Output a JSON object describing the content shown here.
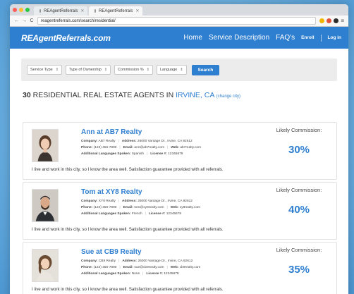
{
  "browser": {
    "tabs": [
      {
        "label": "REAgentReferrals"
      },
      {
        "label": "REAgentReferrals"
      }
    ],
    "url": "reagentreferrals.com/search/residential/",
    "colors": {
      "close": "#ff5f57",
      "min": "#febc2e",
      "max": "#28c840"
    }
  },
  "site": {
    "logo": "REAgentReferrals.com",
    "nav": {
      "home": "Home",
      "service": "Service Description",
      "faq": "FAQ's",
      "enroll": "Enroll",
      "login": "Log in"
    },
    "accent": "#2f7fd0"
  },
  "filters": {
    "service_type": "Service Type",
    "ownership": "Type of Ownership",
    "commission": "Commission %",
    "language": "Language",
    "search": "Search"
  },
  "results": {
    "count": "30",
    "label": "RESIDENTIAL REAL ESTATE AGENTS IN",
    "city": "IRVINE, CA",
    "change": "(change city)"
  },
  "commission_label": "Likely Commission:",
  "agents": [
    {
      "name": "Ann at AB7 Realty",
      "company": "AB7 Realty",
      "address": "26000 Vantage Dr., Irvine, CA 92612",
      "phone": "(123) 456-7890",
      "email": "ann@ab7realty.com",
      "web": "ab7realty.com",
      "languages": "Spanish",
      "license": "12345678",
      "description": "I live and work in this city, so I know the area well. Satisfaction guarantee provided with all referrals.",
      "commission": "30%"
    },
    {
      "name": "Tom at XY8 Realty",
      "company": "XY8 Realty",
      "address": "25000 Vantage Dr., Irvine, CA 92612",
      "phone": "(123) 456-7890",
      "email": "tom@xy8realty.com",
      "web": "xy8realty.com",
      "languages": "French",
      "license": "12345678",
      "description": "I live and work in this city, so I know the area well. Satisfaction guarantee provided with all referrals.",
      "commission": "40%"
    },
    {
      "name": "Sue at CB9 Realty",
      "company": "CB9 Realty",
      "address": "26000 Vantage Dr., Irvine, CA 92612",
      "phone": "(123) 456-7890",
      "email": "sue@cb9realty.com",
      "web": "cb9realty.com",
      "languages": "None",
      "license": "12345678",
      "description": "I live and work in this city, so I know the area well. Satisfaction guarantee provided with all referrals.",
      "commission": "35%"
    }
  ]
}
